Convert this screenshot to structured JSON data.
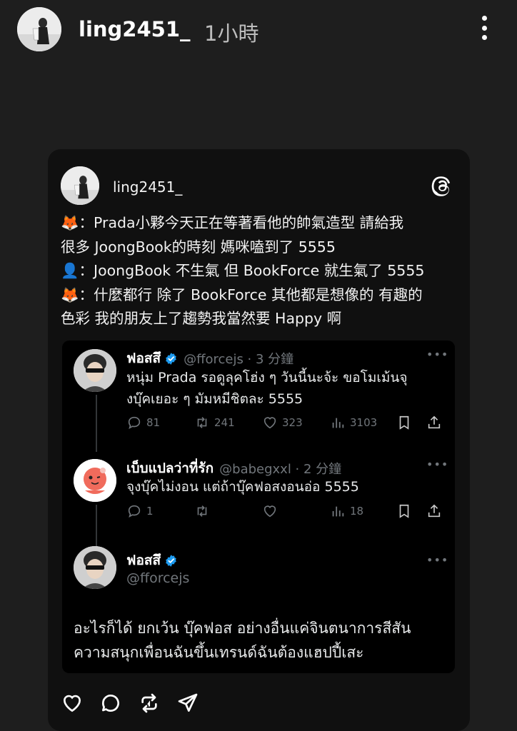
{
  "story": {
    "username": "ling2451_",
    "time": "1小時"
  },
  "post": {
    "username": "ling2451_",
    "lines": [
      "🦊：Prada小夥今天正在等著看他的帥氣造型 請給我",
      "很多 JoongBook的時刻 媽咪嗑到了 5555",
      "👤：JoongBook 不生氣 但 BookForce 就生氣了 5555",
      "🦊：什麼都行 除了 BookForce 其他都是想像的 有趣的",
      "色彩 我的朋友上了趨勢我當然要 Happy 啊"
    ]
  },
  "tweets": [
    {
      "name": "ฟอสสึ",
      "handle": "@fforcejs · 3 分鐘",
      "verified": true,
      "lines": [
        "หนุ่ม Prada รอดูลุคโฮ่ง ๆ วันนี้นะจ้ะ ขอโมเม้นจุ",
        "งบุ๊คเยอะ ๆ มัมหมีชิตละ 5555"
      ],
      "replies": "81",
      "retweets": "241",
      "likes": "323",
      "views": "3103"
    },
    {
      "name": "เบ็บแปลว่าที่รัก",
      "handle": "@babegxxl · 2 分鐘",
      "verified": false,
      "lines": [
        "จุงบุ๊คไม่งอน แต่ถ้าบุ๊คฟอสงอนอ่อ 5555"
      ],
      "replies": "1",
      "retweets": "",
      "likes": "",
      "views": "18"
    },
    {
      "name": "ฟอสสึ",
      "handle": "@fforcejs",
      "verified": true,
      "lines": [
        "อะไรก็ได้ ยกเว้น บุ๊คฟอส อย่างอื่นแค่จินตนาการสีสัน",
        "ความสนุกเพื่อนฉันขึ้นเทรนด์ฉันต้องแฮปปี้เสะ"
      ]
    }
  ],
  "icons": {
    "more": "more-vertical-icon",
    "threads": "threads-logo-icon",
    "verified": "verified-badge-icon",
    "reply": "reply-icon",
    "retweet": "retweet-icon",
    "like": "heart-icon",
    "views": "views-icon",
    "bookmark": "bookmark-icon",
    "share": "share-icon",
    "post_actions": [
      "heart-icon",
      "comment-icon",
      "repost-icon",
      "send-icon"
    ]
  },
  "colors": {
    "background": "#1e1e1e",
    "card": "#101010",
    "tweet_card": "#000000",
    "verified": "#1d9bf0",
    "muted": "#71767b"
  }
}
